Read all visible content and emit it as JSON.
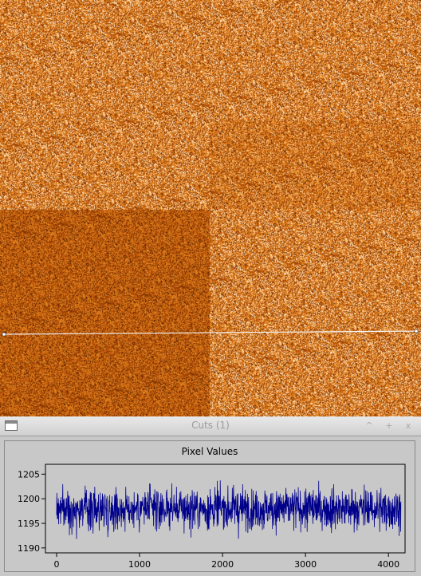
{
  "image_view": {
    "colormap": "heat",
    "colors": {
      "dark": "#3a1a00",
      "mid": "#c96f14",
      "light": "#ffd7a0",
      "cut_line": "#f2f2f2"
    }
  },
  "cuts_window": {
    "title": "Cuts (1)",
    "buttons": {
      "minimize": "^",
      "maximize": "+",
      "close": "x"
    }
  },
  "chart_data": {
    "type": "line",
    "title": "Pixel Values",
    "xlabel": "",
    "ylabel": "",
    "xlim": [
      0,
      4200
    ],
    "ylim": [
      1189,
      1207
    ],
    "x_ticks": [
      0,
      1000,
      2000,
      3000,
      4000
    ],
    "y_ticks": [
      1190,
      1195,
      1200,
      1205
    ],
    "series": [
      {
        "color": "#00008b",
        "x_start": 0,
        "x_end": 4150,
        "mean": 1198,
        "std": 2.1,
        "min": 1190,
        "max": 1206
      }
    ],
    "grid": false
  }
}
